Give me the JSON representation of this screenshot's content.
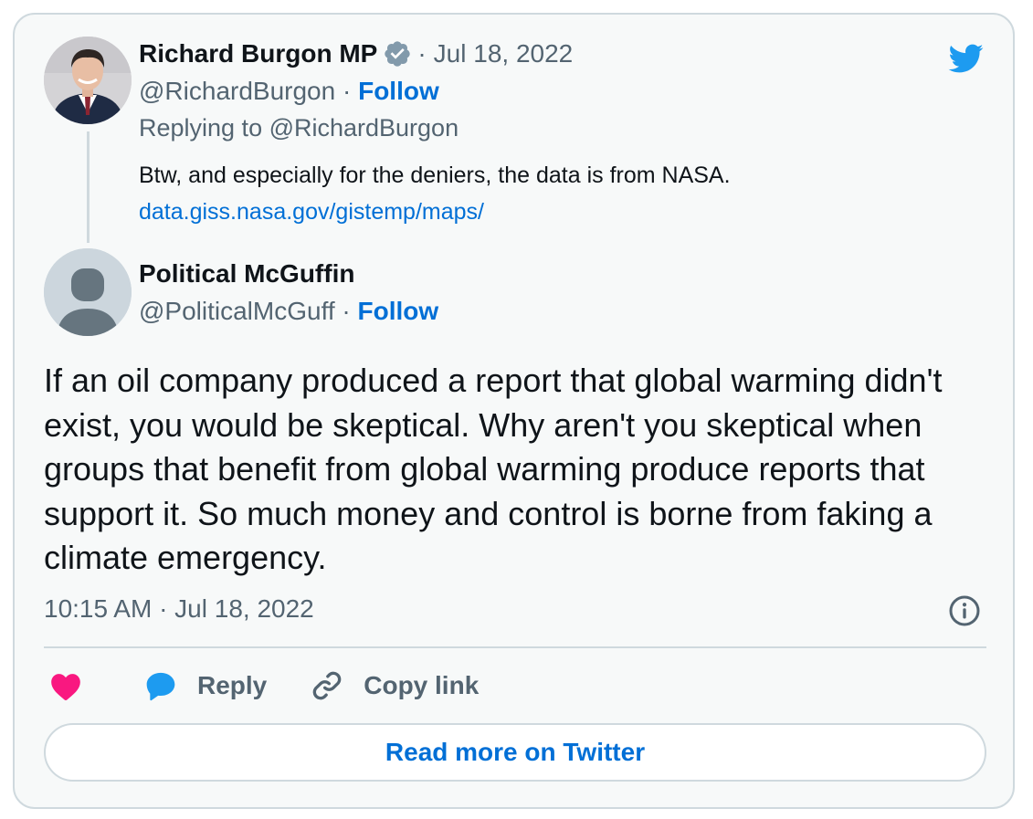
{
  "parent_tweet": {
    "author_name": "Richard Burgon MP",
    "date": "Jul 18, 2022",
    "date_separator": "·",
    "handle": "@RichardBurgon",
    "handle_separator": "·",
    "follow_label": "Follow",
    "replying_to": "Replying to @RichardBurgon",
    "text": "Btw, and especially for the deniers, the data is from NASA.",
    "link": "data.giss.nasa.gov/gistemp/maps/"
  },
  "main_tweet": {
    "author_name": "Political McGuffin",
    "handle": "@PoliticalMcGuff",
    "handle_separator": "·",
    "follow_label": "Follow",
    "text": "If an oil company produced a report that global warming didn't exist, you would be skeptical. Why aren't you skeptical when groups that benefit from global warming produce reports that support it. So much money and control is borne from faking a climate emergency.",
    "timestamp": "10:15 AM · Jul 18, 2022"
  },
  "actions": {
    "like_icon": "heart-icon",
    "reply_label": "Reply",
    "copy_link_label": "Copy link"
  },
  "read_more_label": "Read more on Twitter",
  "colors": {
    "accent": "#006fd6",
    "twitter_blue": "#1d9bf0",
    "like": "#f91880",
    "muted": "#536471",
    "border": "#cfd9de",
    "background": "#f7f9f9"
  }
}
